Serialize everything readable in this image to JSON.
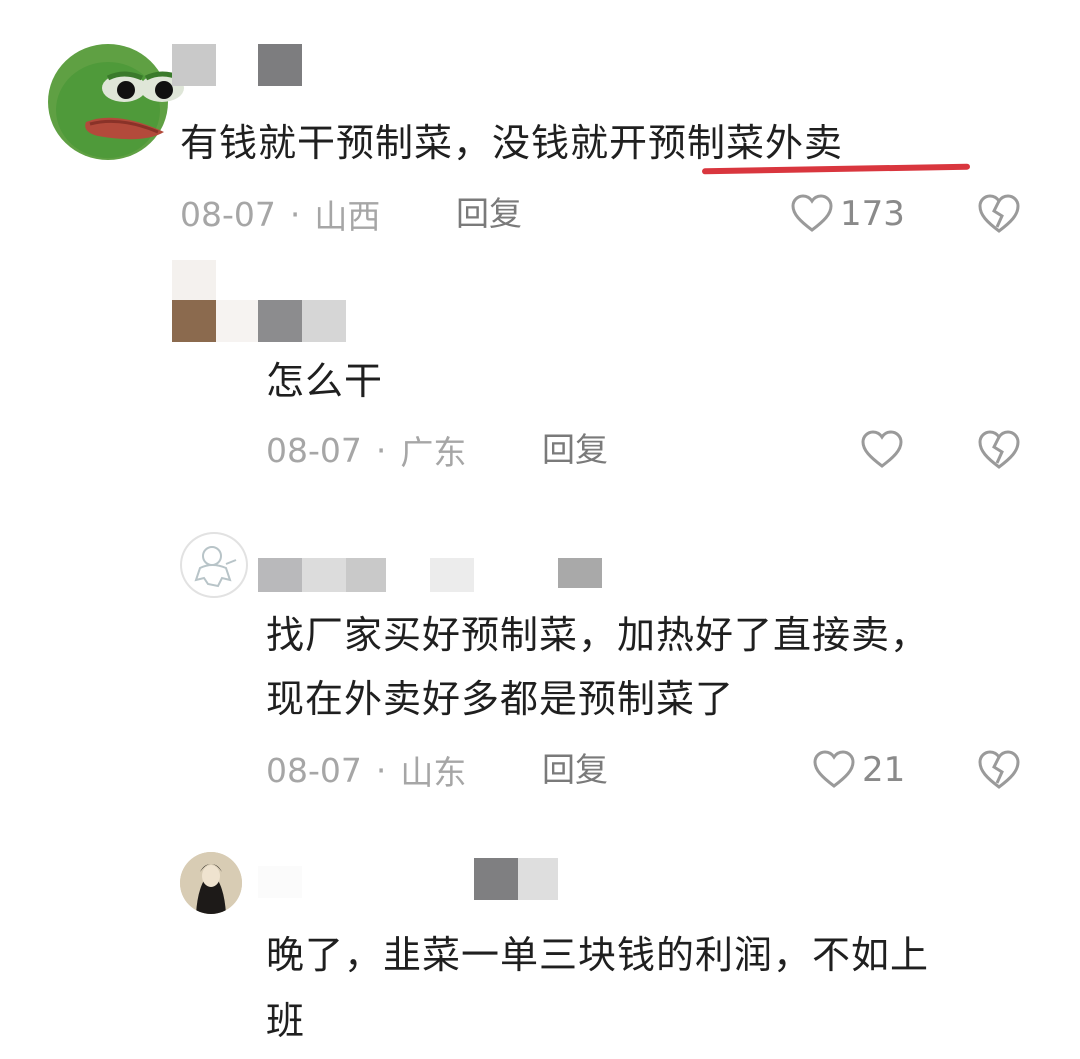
{
  "comments": [
    {
      "text": "有钱就干预制菜，没钱就开预制菜外卖",
      "date": "08-07",
      "location": "山西",
      "reply_label": "回复",
      "likes": "173"
    },
    {
      "text": "怎么干",
      "date": "08-07",
      "location": "广东",
      "reply_label": "回复",
      "likes": ""
    },
    {
      "text_line1": "找厂家买好预制菜，加热好了直接卖，",
      "text_line2": "现在外卖好多都是预制菜了",
      "date": "08-07",
      "location": "山东",
      "reply_label": "回复",
      "likes": "21"
    },
    {
      "text_line1": "晚了，韭菜一单三块钱的利润，不如上",
      "text_line2": "班"
    }
  ],
  "separator": "·",
  "icons": {
    "like": "heart-outline-icon",
    "dislike": "broken-heart-icon"
  },
  "colors": {
    "underline": "#d9363e",
    "meta_text": "#a6a6a6",
    "avatar_frog": "#4f9a3a"
  }
}
